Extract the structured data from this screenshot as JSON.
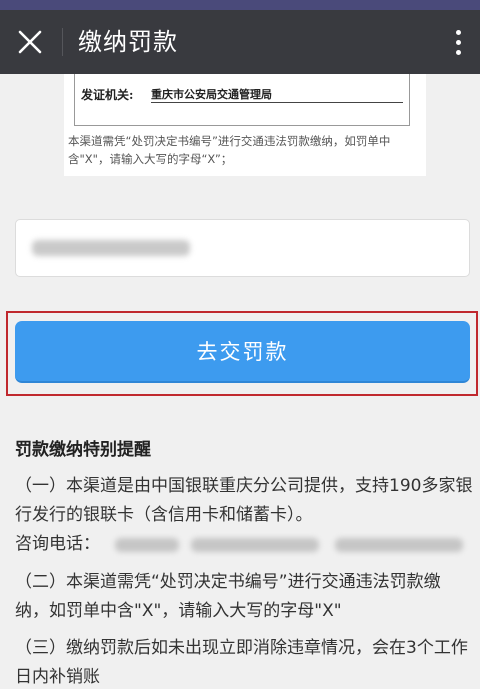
{
  "header": {
    "title": "缴纳罚款"
  },
  "sample": {
    "label": "发证机关:",
    "value": "重庆市公安局交通管理局",
    "note": "本渠道需凭“处罚决定书编号”进行交通违法罚款缴纳，如罚单中含\"X\"，请输入大写的字母“X”；"
  },
  "input": {
    "value": "●●●●●●●●●●●●●●●"
  },
  "actions": {
    "pay_label": "去交罚款"
  },
  "notice": {
    "title": "罚款缴纳特别提醒",
    "item1": "（一）本渠道是由中国银联重庆分公司提供，支持190多家银行发行的银联卡（含信用卡和储蓄卡）。",
    "phone_label": "咨询电话：",
    "item2": "（二）本渠道需凭“处罚决定书编号”进行交通违法罚款缴纳，如罚单中含\"X\"，请输入大写的字母\"X\"",
    "item3": "（三）缴纳罚款后如未出现立即消除违章情况，会在3个工作日内补销账"
  },
  "colors": {
    "header_bg": "#393a3f",
    "button_bg": "#3d9bef",
    "highlight_border": "#c0282e"
  },
  "icons": {
    "close": "close-icon",
    "more": "more-vertical-icon"
  }
}
